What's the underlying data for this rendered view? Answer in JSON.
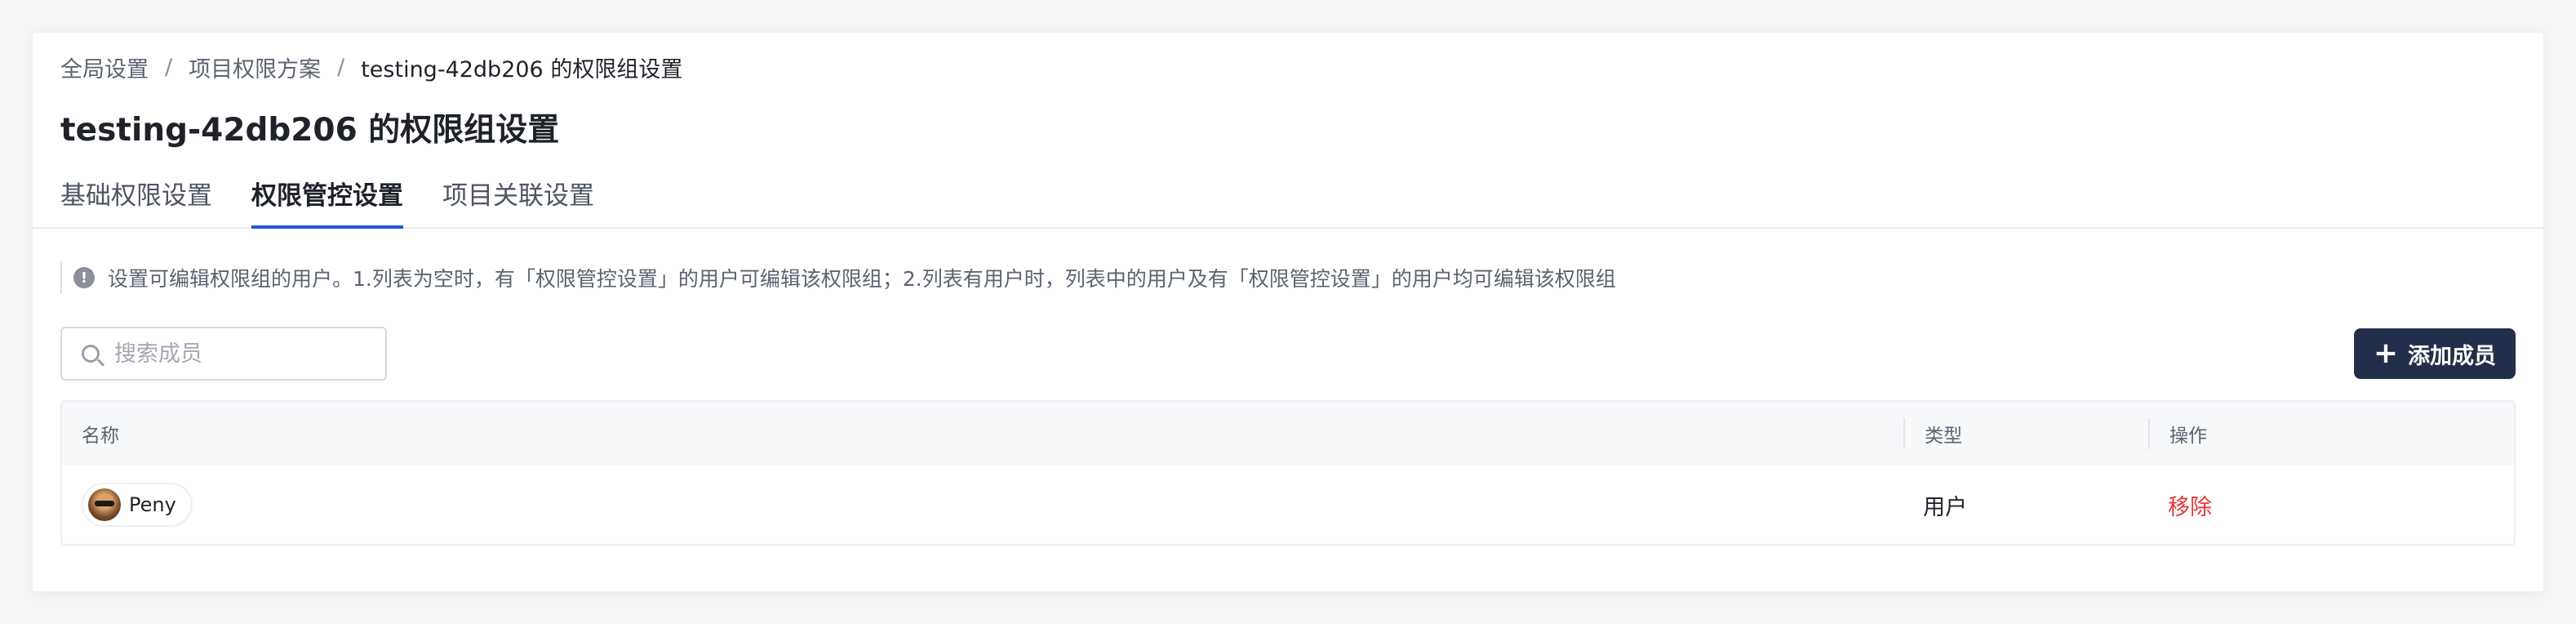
{
  "breadcrumb": {
    "items": [
      "全局设置",
      "项目权限方案",
      "testing-42db206 的权限组设置"
    ],
    "separator": "/"
  },
  "page_title": "testing-42db206 的权限组设置",
  "tabs": [
    {
      "label": "基础权限设置",
      "active": false
    },
    {
      "label": "权限管控设置",
      "active": true
    },
    {
      "label": "项目关联设置",
      "active": false
    }
  ],
  "notice": {
    "icon": "info-icon",
    "text": "设置可编辑权限组的用户。1.列表为空时，有「权限管控设置」的用户可编辑该权限组；2.列表有用户时，列表中的用户及有「权限管控设置」的用户均可编辑该权限组"
  },
  "search": {
    "placeholder": "搜索成员",
    "value": ""
  },
  "add_button": {
    "label": "添加成员",
    "icon": "plus-icon"
  },
  "table": {
    "columns": [
      "名称",
      "类型",
      "操作"
    ],
    "rows": [
      {
        "name": "Peny",
        "type": "用户",
        "action": "移除"
      }
    ]
  },
  "colors": {
    "accent": "#2458d6",
    "primary_button": "#232f4a",
    "danger": "#e53935"
  }
}
